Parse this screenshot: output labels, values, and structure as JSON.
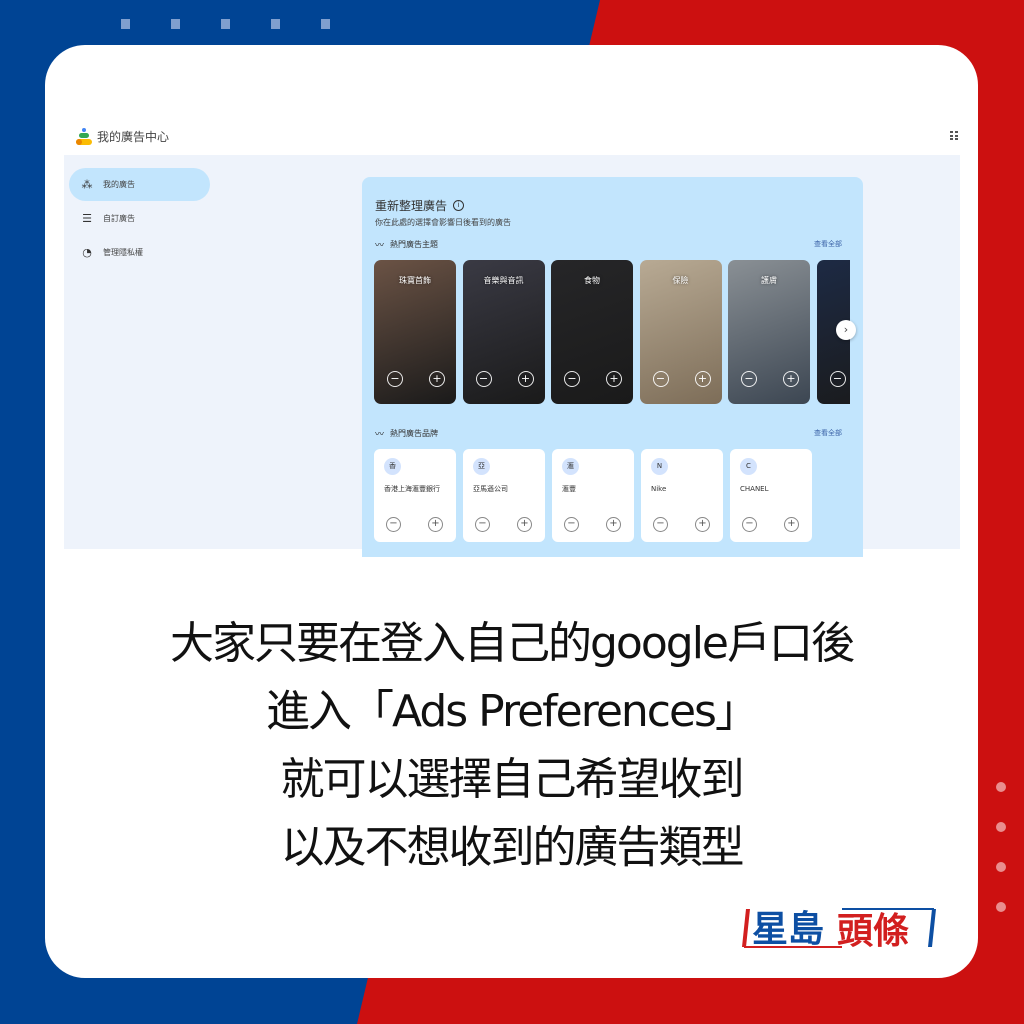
{
  "app": {
    "title": "我的廣告中心"
  },
  "nav": [
    {
      "label": "我的廣告",
      "icon": "shapes-icon",
      "active": true
    },
    {
      "label": "自訂廣告",
      "icon": "sliders-icon",
      "active": false
    },
    {
      "label": "管理隱私權",
      "icon": "privacy-icon",
      "active": false
    }
  ],
  "panel": {
    "title": "重新整理廣告",
    "subtitle": "你在此處的選擇會影響日後看到的廣告",
    "topics_heading": "熱門廣告主題",
    "brands_heading": "熱門廣告品牌",
    "view_all": "查看全部"
  },
  "topics": [
    {
      "title": "珠寶首飾",
      "color": "#6b5345"
    },
    {
      "title": "音樂與音訊",
      "color": "#3a3a44"
    },
    {
      "title": "食物",
      "color": "#262628"
    },
    {
      "title": "保險",
      "color": "#a89a86"
    },
    {
      "title": "護膚",
      "color": "#6e767c"
    },
    {
      "title": "",
      "color": "#1d2a44"
    }
  ],
  "brands": [
    {
      "initial": "香",
      "name": "香港上海滙豐銀行"
    },
    {
      "initial": "亞",
      "name": "亞馬遜公司"
    },
    {
      "initial": "滙",
      "name": "滙豐"
    },
    {
      "initial": "N",
      "name": "Nike"
    },
    {
      "initial": "C",
      "name": "CHANEL"
    }
  ],
  "symbols": {
    "minus": "−",
    "plus": "+",
    "next": "›",
    "info": "i"
  },
  "caption": {
    "line1": "大家只要在登入自己的google戶口後",
    "line2": "進入「Ads Preferences」",
    "line3": "就可以選擇自己希望收到",
    "line4": "以及不想收到的廣告類型"
  },
  "logo": {
    "part1": "星島",
    "part2": "頭條",
    "blue": "#0d4fa3",
    "red": "#d21f1f"
  },
  "colors": {
    "blue_bg": "#004494",
    "red_bg": "#cc1010",
    "panel": "#c2e5fd"
  }
}
